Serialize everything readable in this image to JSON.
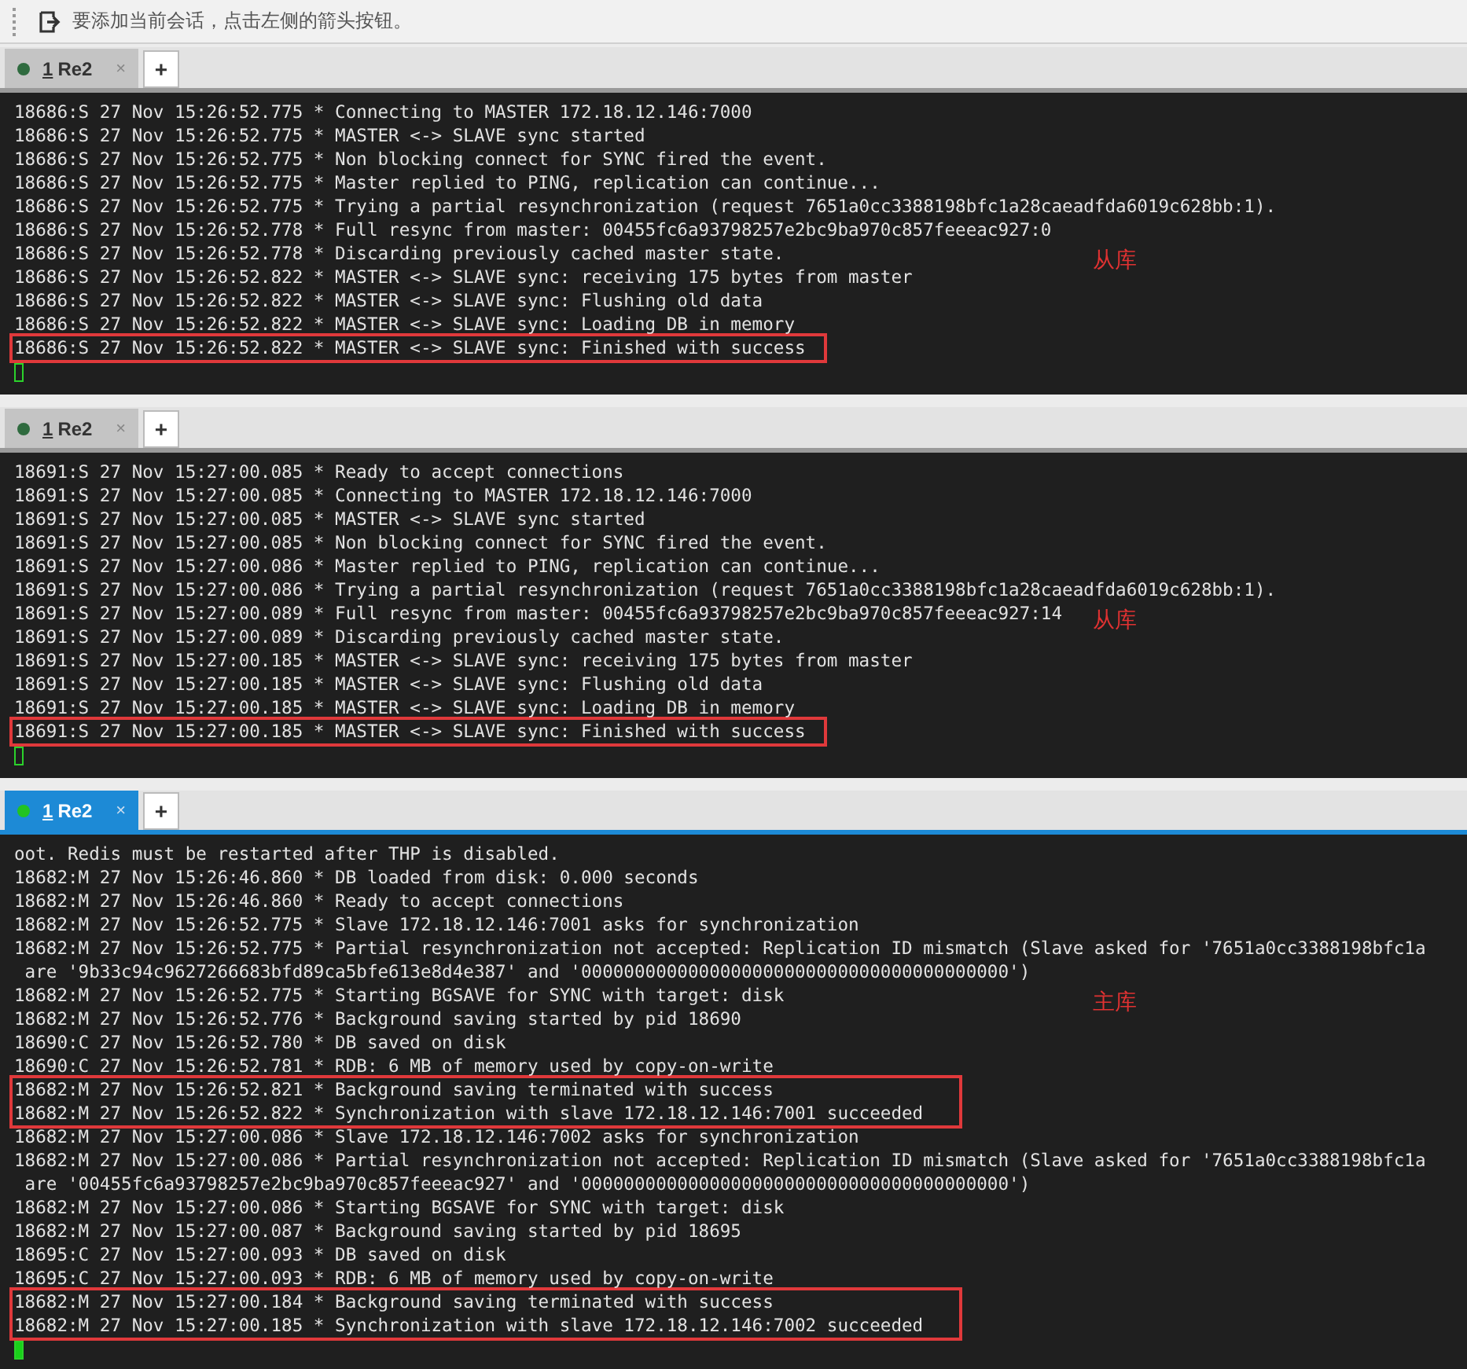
{
  "hint_bar": {
    "text": "要添加当前会话，点击左侧的箭头按钮。"
  },
  "panes": [
    {
      "active": false,
      "tab": {
        "key": "1",
        "title": "Re2",
        "selected": false,
        "close": "×"
      },
      "new_tab": "+",
      "annotation": "从库",
      "lines": [
        {
          "text": "18686:S 27 Nov 15:26:52.775 * Connecting to MASTER 172.18.12.146:7000",
          "boxed": false
        },
        {
          "text": "18686:S 27 Nov 15:26:52.775 * MASTER <-> SLAVE sync started",
          "boxed": false
        },
        {
          "text": "18686:S 27 Nov 15:26:52.775 * Non blocking connect for SYNC fired the event.",
          "boxed": false
        },
        {
          "text": "18686:S 27 Nov 15:26:52.775 * Master replied to PING, replication can continue...",
          "boxed": false
        },
        {
          "text": "18686:S 27 Nov 15:26:52.775 * Trying a partial resynchronization (request 7651a0cc3388198bfc1a28caeadfda6019c628bb:1).",
          "boxed": false
        },
        {
          "text": "18686:S 27 Nov 15:26:52.778 * Full resync from master: 00455fc6a93798257e2bc9ba970c857feeeac927:0",
          "boxed": false
        },
        {
          "text": "18686:S 27 Nov 15:26:52.778 * Discarding previously cached master state.",
          "boxed": false
        },
        {
          "text": "18686:S 27 Nov 15:26:52.822 * MASTER <-> SLAVE sync: receiving 175 bytes from master",
          "boxed": false
        },
        {
          "text": "18686:S 27 Nov 15:26:52.822 * MASTER <-> SLAVE sync: Flushing old data",
          "boxed": false
        },
        {
          "text": "18686:S 27 Nov 15:26:52.822 * MASTER <-> SLAVE sync: Loading DB in memory",
          "boxed": false
        },
        {
          "text": "18686:S 27 Nov 15:26:52.822 * MASTER <-> SLAVE sync: Finished with success",
          "boxed": true
        }
      ]
    },
    {
      "active": false,
      "tab": {
        "key": "1",
        "title": "Re2",
        "selected": false,
        "close": "×"
      },
      "new_tab": "+",
      "annotation": "从库",
      "lines": [
        {
          "text": "18691:S 27 Nov 15:27:00.085 * Ready to accept connections",
          "boxed": false
        },
        {
          "text": "18691:S 27 Nov 15:27:00.085 * Connecting to MASTER 172.18.12.146:7000",
          "boxed": false
        },
        {
          "text": "18691:S 27 Nov 15:27:00.085 * MASTER <-> SLAVE sync started",
          "boxed": false
        },
        {
          "text": "18691:S 27 Nov 15:27:00.085 * Non blocking connect for SYNC fired the event.",
          "boxed": false
        },
        {
          "text": "18691:S 27 Nov 15:27:00.086 * Master replied to PING, replication can continue...",
          "boxed": false
        },
        {
          "text": "18691:S 27 Nov 15:27:00.086 * Trying a partial resynchronization (request 7651a0cc3388198bfc1a28caeadfda6019c628bb:1).",
          "boxed": false
        },
        {
          "text": "18691:S 27 Nov 15:27:00.089 * Full resync from master: 00455fc6a93798257e2bc9ba970c857feeeac927:14",
          "boxed": false
        },
        {
          "text": "18691:S 27 Nov 15:27:00.089 * Discarding previously cached master state.",
          "boxed": false
        },
        {
          "text": "18691:S 27 Nov 15:27:00.185 * MASTER <-> SLAVE sync: receiving 175 bytes from master",
          "boxed": false
        },
        {
          "text": "18691:S 27 Nov 15:27:00.185 * MASTER <-> SLAVE sync: Flushing old data",
          "boxed": false
        },
        {
          "text": "18691:S 27 Nov 15:27:00.185 * MASTER <-> SLAVE sync: Loading DB in memory",
          "boxed": false
        },
        {
          "text": "18691:S 27 Nov 15:27:00.185 * MASTER <-> SLAVE sync: Finished with success",
          "boxed": true
        }
      ]
    },
    {
      "active": true,
      "tab": {
        "key": "1",
        "title": "Re2",
        "selected": true,
        "close": "×"
      },
      "new_tab": "+",
      "annotation": "主库",
      "lines": [
        {
          "text": "oot. Redis must be restarted after THP is disabled.",
          "boxed": false
        },
        {
          "text": "18682:M 27 Nov 15:26:46.860 * DB loaded from disk: 0.000 seconds",
          "boxed": false
        },
        {
          "text": "18682:M 27 Nov 15:26:46.860 * Ready to accept connections",
          "boxed": false
        },
        {
          "text": "18682:M 27 Nov 15:26:52.775 * Slave 172.18.12.146:7001 asks for synchronization",
          "boxed": false
        },
        {
          "text": "18682:M 27 Nov 15:26:52.775 * Partial resynchronization not accepted: Replication ID mismatch (Slave asked for '7651a0cc3388198bfc1a",
          "boxed": false
        },
        {
          "text": " are '9b33c94c9627266683bfd89ca5bfe613e8d4e387' and '0000000000000000000000000000000000000000')",
          "boxed": false
        },
        {
          "text": "18682:M 27 Nov 15:26:52.775 * Starting BGSAVE for SYNC with target: disk",
          "boxed": false
        },
        {
          "text": "18682:M 27 Nov 15:26:52.776 * Background saving started by pid 18690",
          "boxed": false
        },
        {
          "text": "18690:C 27 Nov 15:26:52.780 * DB saved on disk",
          "boxed": false
        },
        {
          "text": "18690:C 27 Nov 15:26:52.781 * RDB: 6 MB of memory used by copy-on-write",
          "boxed": false
        },
        {
          "text": "18682:M 27 Nov 15:26:52.821 * Background saving terminated with success",
          "boxed": true
        },
        {
          "text": "18682:M 27 Nov 15:26:52.822 * Synchronization with slave 172.18.12.146:7001 succeeded",
          "boxed": true
        },
        {
          "text": "18682:M 27 Nov 15:27:00.086 * Slave 172.18.12.146:7002 asks for synchronization",
          "boxed": false
        },
        {
          "text": "18682:M 27 Nov 15:27:00.086 * Partial resynchronization not accepted: Replication ID mismatch (Slave asked for '7651a0cc3388198bfc1a",
          "boxed": false
        },
        {
          "text": " are '00455fc6a93798257e2bc9ba970c857feeeac927' and '0000000000000000000000000000000000000000')",
          "boxed": false
        },
        {
          "text": "18682:M 27 Nov 15:27:00.086 * Starting BGSAVE for SYNC with target: disk",
          "boxed": false
        },
        {
          "text": "18682:M 27 Nov 15:27:00.087 * Background saving started by pid 18695",
          "boxed": false
        },
        {
          "text": "18695:C 27 Nov 15:27:00.093 * DB saved on disk",
          "boxed": false
        },
        {
          "text": "18695:C 27 Nov 15:27:00.093 * RDB: 6 MB of memory used by copy-on-write",
          "boxed": false
        },
        {
          "text": "18682:M 27 Nov 15:27:00.184 * Background saving terminated with success",
          "boxed": true
        },
        {
          "text": "18682:M 27 Nov 15:27:00.185 * Synchronization with slave 172.18.12.146:7002 succeeded",
          "boxed": true
        }
      ]
    }
  ]
}
